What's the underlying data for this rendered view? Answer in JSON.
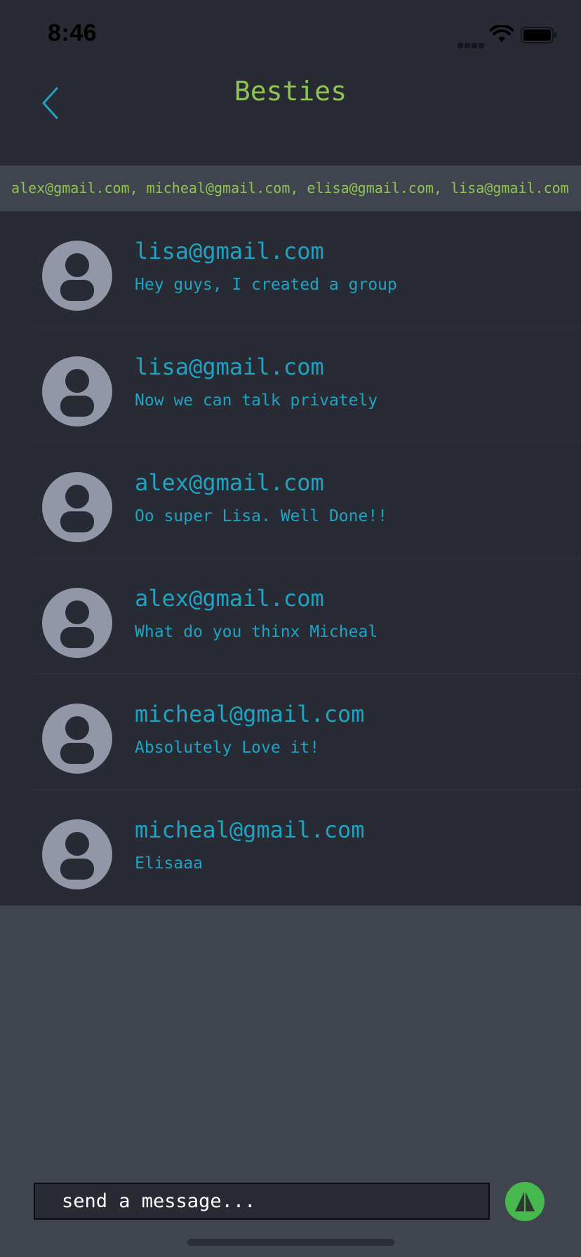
{
  "status_bar": {
    "time": "8:46",
    "icons": [
      "signal-icon",
      "wifi-icon",
      "battery-icon"
    ]
  },
  "nav": {
    "back_icon": "chevron-left-icon",
    "title": "Besties"
  },
  "group": {
    "members": "alex@gmail.com, micheal@gmail.com, elisa@gmail.com, lisa@gmail.com"
  },
  "messages": [
    {
      "sender": "lisa@gmail.com",
      "text": "Hey guys, I created a group"
    },
    {
      "sender": "lisa@gmail.com",
      "text": "Now we can talk privately"
    },
    {
      "sender": "alex@gmail.com",
      "text": "Oo super Lisa. Well Done!!"
    },
    {
      "sender": "alex@gmail.com",
      "text": "What do you thinx Micheal"
    },
    {
      "sender": "micheal@gmail.com",
      "text": "Absolutely Love it!"
    },
    {
      "sender": "micheal@gmail.com",
      "text": "Elisaaa"
    }
  ],
  "composer": {
    "placeholder": "send a message...",
    "value": "",
    "send_icon": "send-icon"
  },
  "colors": {
    "background_dark": "#282a34",
    "background_light": "#40444f",
    "title_green": "#8fc455",
    "accent_teal": "#1fa3c3",
    "avatar_gray": "#9297a8",
    "send_green": "#47b84d"
  }
}
